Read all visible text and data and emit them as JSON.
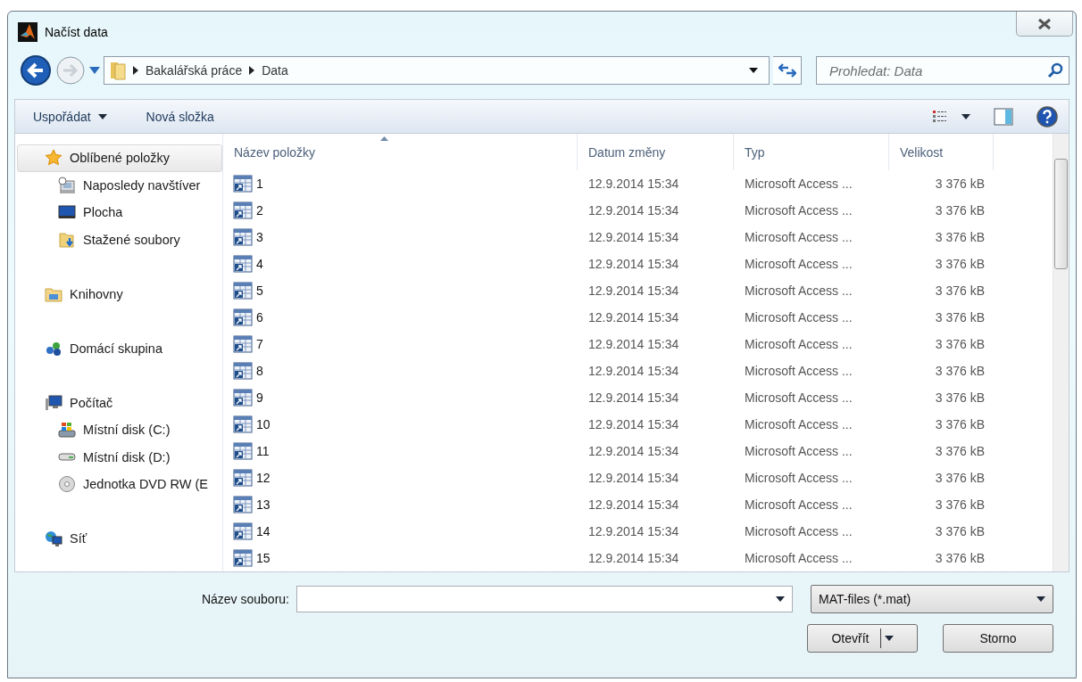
{
  "window": {
    "title": "Načíst data"
  },
  "breadcrumb": [
    "Bakalářská práce",
    "Data"
  ],
  "search": {
    "placeholder": "Prohledat: Data"
  },
  "toolbar": {
    "organize": "Uspořádat",
    "new_folder": "Nová složka"
  },
  "sidebar": {
    "groups": [
      {
        "label": "Oblíbené položky",
        "selected": true,
        "children": [
          {
            "label": "Naposledy navštíver",
            "selected": false
          },
          {
            "label": "Plocha",
            "selected": false
          },
          {
            "label": "Stažené soubory",
            "selected": false
          }
        ]
      },
      {
        "label": "Knihovny",
        "selected": false
      },
      {
        "label": "Domácí skupina",
        "selected": false
      },
      {
        "label": "Počítač",
        "selected": false,
        "children": [
          {
            "label": "Místní disk (C:)",
            "selected": false
          },
          {
            "label": "Místní disk (D:)",
            "selected": false
          },
          {
            "label": "Jednotka DVD RW (E",
            "selected": false
          }
        ]
      },
      {
        "label": "Síť",
        "selected": false
      }
    ]
  },
  "table": {
    "columns": [
      "Název položky",
      "Datum změny",
      "Typ",
      "Velikost"
    ],
    "rows": [
      {
        "name": "1",
        "date": "12.9.2014 15:34",
        "type": "Microsoft Access ...",
        "size": "3 376 kB"
      },
      {
        "name": "2",
        "date": "12.9.2014 15:34",
        "type": "Microsoft Access ...",
        "size": "3 376 kB"
      },
      {
        "name": "3",
        "date": "12.9.2014 15:34",
        "type": "Microsoft Access ...",
        "size": "3 376 kB"
      },
      {
        "name": "4",
        "date": "12.9.2014 15:34",
        "type": "Microsoft Access ...",
        "size": "3 376 kB"
      },
      {
        "name": "5",
        "date": "12.9.2014 15:34",
        "type": "Microsoft Access ...",
        "size": "3 376 kB"
      },
      {
        "name": "6",
        "date": "12.9.2014 15:34",
        "type": "Microsoft Access ...",
        "size": "3 376 kB"
      },
      {
        "name": "7",
        "date": "12.9.2014 15:34",
        "type": "Microsoft Access ...",
        "size": "3 376 kB"
      },
      {
        "name": "8",
        "date": "12.9.2014 15:34",
        "type": "Microsoft Access ...",
        "size": "3 376 kB"
      },
      {
        "name": "9",
        "date": "12.9.2014 15:34",
        "type": "Microsoft Access ...",
        "size": "3 376 kB"
      },
      {
        "name": "10",
        "date": "12.9.2014 15:34",
        "type": "Microsoft Access ...",
        "size": "3 376 kB"
      },
      {
        "name": "11",
        "date": "12.9.2014 15:34",
        "type": "Microsoft Access ...",
        "size": "3 376 kB"
      },
      {
        "name": "12",
        "date": "12.9.2014 15:34",
        "type": "Microsoft Access ...",
        "size": "3 376 kB"
      },
      {
        "name": "13",
        "date": "12.9.2014 15:34",
        "type": "Microsoft Access ...",
        "size": "3 376 kB"
      },
      {
        "name": "14",
        "date": "12.9.2014 15:34",
        "type": "Microsoft Access ...",
        "size": "3 376 kB"
      },
      {
        "name": "15",
        "date": "12.9.2014 15:34",
        "type": "Microsoft Access ...",
        "size": "3 376 kB"
      }
    ]
  },
  "footer": {
    "filename_label": "Název souboru:",
    "filter": "MAT-files (*.mat)",
    "open_button": "Otevřít",
    "cancel_button": "Storno"
  }
}
